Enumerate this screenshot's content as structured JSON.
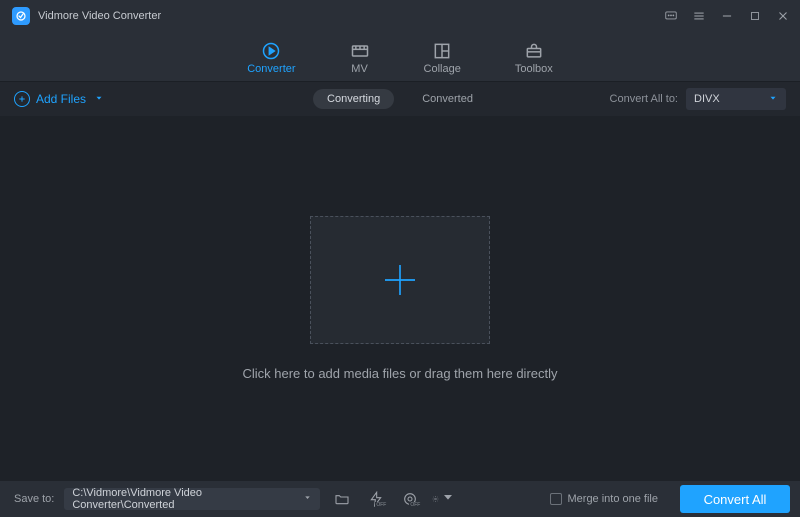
{
  "app": {
    "title": "Vidmore Video Converter"
  },
  "tabs": {
    "converter": "Converter",
    "mv": "MV",
    "collage": "Collage",
    "toolbox": "Toolbox"
  },
  "subbar": {
    "add_files": "Add Files",
    "converting": "Converting",
    "converted": "Converted",
    "convert_all_to_label": "Convert All to:",
    "format_selected": "DIVX"
  },
  "main": {
    "hint": "Click here to add media files or drag them here directly"
  },
  "bottom": {
    "save_to_label": "Save to:",
    "save_path": "C:\\Vidmore\\Vidmore Video Converter\\Converted",
    "off_badge": "OFF",
    "merge_label": "Merge into one file",
    "convert_all_btn": "Convert All"
  }
}
